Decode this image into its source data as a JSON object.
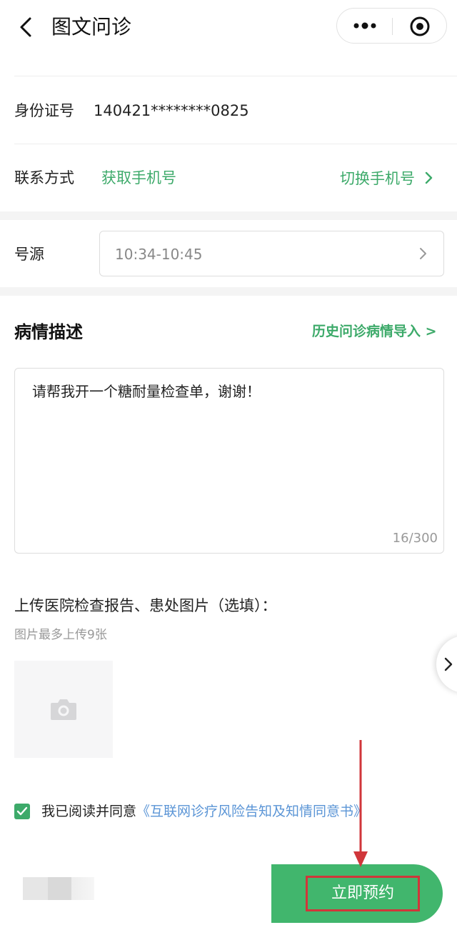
{
  "nav": {
    "title": "图文问诊"
  },
  "patient": {
    "id_label": "身份证号",
    "id_value": "140421********0825",
    "contact_label": "联系方式",
    "get_phone": "获取手机号",
    "switch_phone": "切换手机号"
  },
  "schedule": {
    "label": "号源",
    "slot_value": "10:34-10:45"
  },
  "condition": {
    "title": "病情描述",
    "history_import": "历史问诊病情导入 >",
    "text": "请帮我开一个糖耐量检查单，谢谢！",
    "counter": "16/300"
  },
  "upload": {
    "title": "上传医院检查报告、患处图片（选填）：",
    "hint": "图片最多上传9张"
  },
  "agreement": {
    "prefix": "我已阅读并同意",
    "link": "《互联网诊疗风险告知及知情同意书》",
    "checked": true
  },
  "footer": {
    "submit": "立即预约"
  },
  "colors": {
    "accent_green": "#3daa6a",
    "button_green": "#41b66d",
    "link_blue": "#5b95d6",
    "annotation_red": "#d0363a"
  },
  "icons": {
    "back": "chevron-left-icon",
    "more": "more-dots-icon",
    "close": "target-circle-icon",
    "chevron": "chevron-right-icon",
    "camera": "camera-icon",
    "check": "checkmark-icon"
  }
}
